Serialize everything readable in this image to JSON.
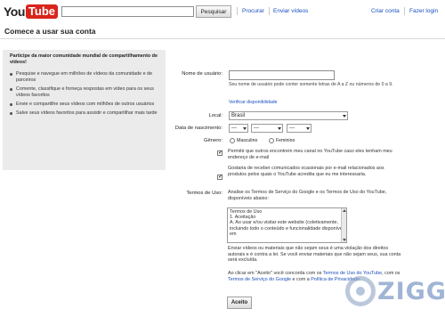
{
  "header": {
    "logo_you": "You",
    "logo_tube": "Tube",
    "search_value": "",
    "search_button": "Pesquisar",
    "links": [
      "Procurar",
      "Enviar vídeos",
      "Criar conta",
      "Fazer login"
    ]
  },
  "page_title": "Comece a usar sua conta",
  "left_panel": {
    "heading": "Participe da maior comunidade mundial de compartilhamento de vídeos!",
    "bullets": [
      "Pesquise e navegue em milhões de vídeos da comunidade e de parceiros",
      "Comente, classifique e forneça respostas em vídeo para os seus vídeos favoritos",
      "Envie e compartilhe seus vídeos com milhões de outros usuários",
      "Salve seus vídeos favoritos para assistir e compartilhar mais tarde"
    ]
  },
  "form": {
    "username_label": "Nome de usuário:",
    "username_value": "",
    "username_hint": "Seu nome de usuário pode conter somente letras de A a Z ou números de 0 a 9.",
    "check_availability": "Verificar disponibilidade",
    "location_label": "Local:",
    "location_value": "Brasil",
    "birthdate_label": "Data de nascimento:",
    "birth_day": "---",
    "birth_month": "---",
    "birth_year": "---",
    "gender_label": "Gênero:",
    "gender_male": "Masculino",
    "gender_female": "Feminino",
    "checkbox1_text": "Permitir que outros encontrem meu canal no YouTube caso eles tenham meu endereço de e-mail",
    "checkbox2_text": "Gostaria de receber comunicados ocasionais por e-mail relacionados aos produtos pelos quais o YouTube acredita que eu me interessaria.",
    "terms_label": "Termos de Uso:",
    "terms_intro": "Analise os Termos de Serviço do Google e os Termos de Uso do YouTube, disponíveis abaixo:",
    "terms_box_lines": [
      "Termos de Uso",
      "1. Aceitação",
      "A. Ao usar e/ou visitar este website (coletivamente,",
      "incluindo todo o conteúdo e funcionalidade disponível em"
    ],
    "violation_text": "Enviar vídeos ou materiais que não sejam seus é uma violação dos direitos autorais e é contra a lei. Se você enviar materiais que não sejam seus, sua conta será excluída.",
    "agree_prefix": "Ao clicar em \"Aceito\" você concorda com os ",
    "agree_tos_link": "Termos de Uso do YouTube",
    "agree_middle": ", com os ",
    "agree_google_link": "Termos de Serviço do Google",
    "agree_and": " e com a ",
    "agree_privacy_link": "Política de Privacidade",
    "agree_end": ".",
    "accept_button": "Aceito"
  },
  "watermark": "ZIGG",
  "colors": {
    "link": "#1a4fbd",
    "youtube_red": "#d8241c",
    "panel_bg": "#ebebeb"
  }
}
